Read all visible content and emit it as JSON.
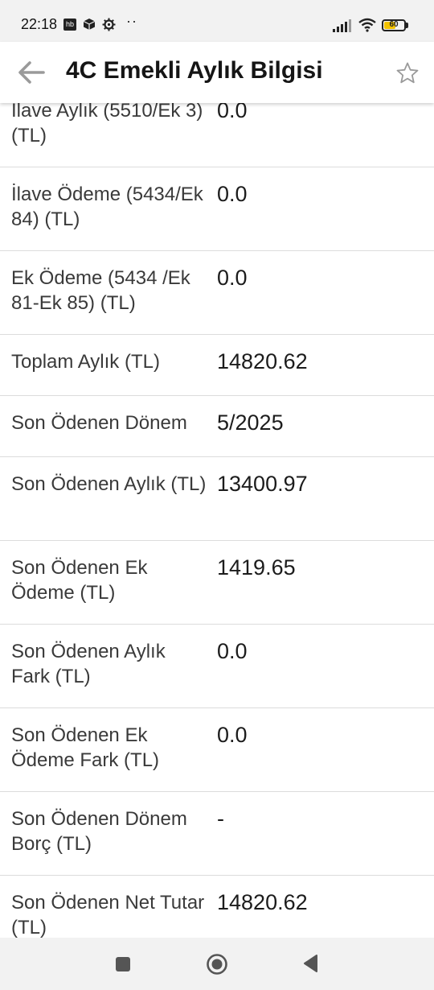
{
  "status_bar": {
    "time": "22:18",
    "hb_badge": "hb",
    "more_dots": "··",
    "battery": "60",
    "battery_level": 0.6
  },
  "header": {
    "title": "4C Emekli Aylık Bilgisi",
    "back_icon": "arrow-left-icon",
    "star_icon": "star-outline-icon"
  },
  "rows": [
    {
      "label": "İlave Aylık (5510/Ek 3) (TL)",
      "value": "0.0"
    },
    {
      "label": "İlave Ödeme (5434/Ek 84) (TL)",
      "value": "0.0"
    },
    {
      "label": "Ek Ödeme (5434 /Ek 81-Ek 85) (TL)",
      "value": "0.0"
    },
    {
      "label": "Toplam Aylık (TL)",
      "value": "14820.62"
    },
    {
      "label": "Son Ödenen Dönem",
      "value": "5/2025"
    },
    {
      "label": "Son Ödenen Aylık (TL)",
      "value": "13400.97"
    },
    {
      "label": "Son Ödenen Ek Ödeme (TL)",
      "value": "1419.65"
    },
    {
      "label": "Son Ödenen Aylık Fark (TL)",
      "value": "0.0"
    },
    {
      "label": "Son Ödenen Ek Ödeme Fark (TL)",
      "value": "0.0"
    },
    {
      "label": "Son Ödenen Dönem Borç (TL)",
      "value": "-"
    },
    {
      "label": "Son Ödenen Net Tutar (TL)",
      "value": "14820.62"
    }
  ],
  "nav_bar": {
    "recents_icon": "square-icon",
    "home_icon": "circle-home-icon",
    "back_icon": "triangle-back-icon"
  },
  "colors": {
    "divider": "#dcdcdc",
    "system_bar": "#f2f2f2",
    "battery_fill": "#f2c200"
  }
}
